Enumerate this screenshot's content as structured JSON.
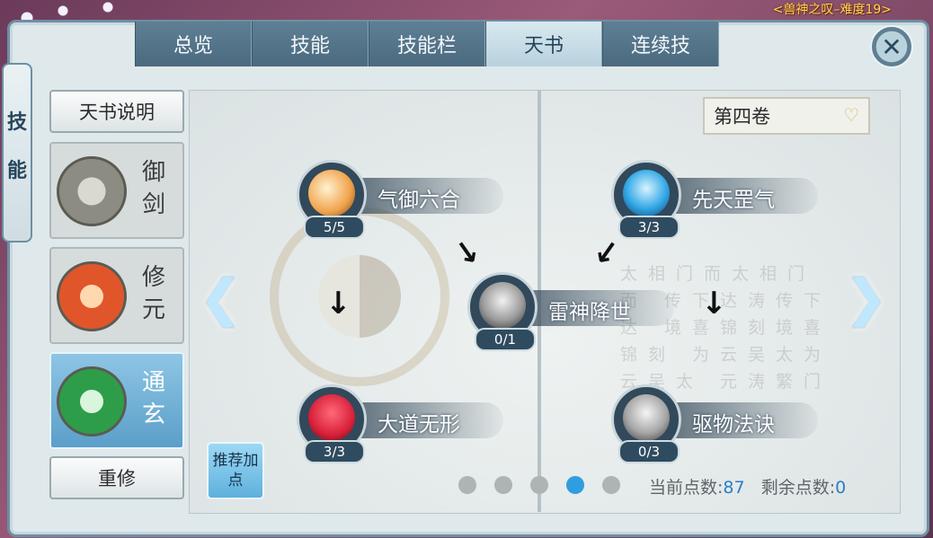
{
  "status_text": "<兽神之叹–难度19>",
  "side_tab": {
    "chars": [
      "技",
      "能"
    ]
  },
  "tabs": [
    {
      "label": "总览",
      "active": false
    },
    {
      "label": "技能",
      "active": false
    },
    {
      "label": "技能栏",
      "active": false
    },
    {
      "label": "天书",
      "active": true
    },
    {
      "label": "连续技",
      "active": false
    }
  ],
  "close_icon": "close-icon",
  "left": {
    "explain_label": "天书说明",
    "schools": [
      {
        "name": "御剑",
        "color": "#8c8c83",
        "active": false
      },
      {
        "name": "修元",
        "color": "#e0562a",
        "active": false
      },
      {
        "name": "通玄",
        "color": "#2e9d4a",
        "active": true
      }
    ],
    "reset_label": "重修"
  },
  "volume": {
    "label": "第四卷",
    "icon": "chevron-down-icon"
  },
  "skills": [
    {
      "name": "气御六合",
      "count": "5/5",
      "color": "#f0a24a"
    },
    {
      "name": "大道无形",
      "count": "3/3",
      "color": "#d8203a"
    },
    {
      "name": "雷神降世",
      "count": "0/1",
      "color": "#9a9a9a"
    },
    {
      "name": "先天罡气",
      "count": "3/3",
      "color": "#33a8e6"
    },
    {
      "name": "驱物法诀",
      "count": "0/3",
      "color": "#a6a6a6"
    }
  ],
  "recommend_label": "推荐加点",
  "pagination": {
    "total": 5,
    "active_index": 3
  },
  "points": {
    "current_label": "当前点数:",
    "current_value": "87",
    "remaining_label": "剩余点数:",
    "remaining_value": "0"
  },
  "calligraphy_text": "太相门而太相门而 传下达涛传下达 境喜锦刻境喜锦刻 为云吴太为云吴太 元涛繁门元涛"
}
